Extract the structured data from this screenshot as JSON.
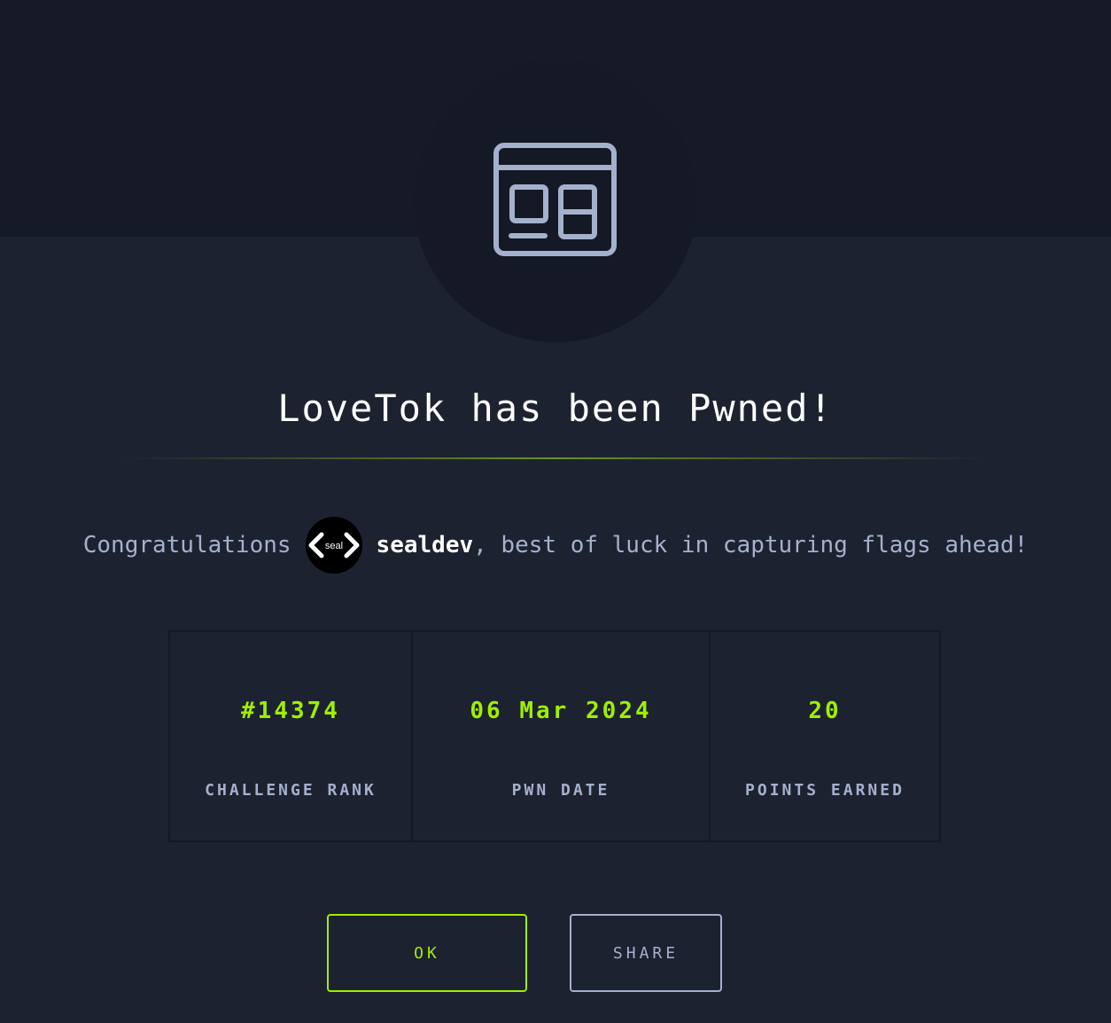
{
  "modal": {
    "icon": "web-layout-icon",
    "title": "LoveTok has been Pwned!",
    "congrats_prefix": "Congratulations",
    "avatar_text": "seal",
    "username": "sealdev",
    "congrats_suffix": ", best of luck in capturing flags ahead!"
  },
  "stats": [
    {
      "value": "#14374",
      "label": "CHALLENGE RANK"
    },
    {
      "value": "06 Mar 2024",
      "label": "PWN DATE"
    },
    {
      "value": "20",
      "label": "POINTS EARNED"
    }
  ],
  "buttons": {
    "ok_label": "OK",
    "share_label": "SHARE"
  },
  "colors": {
    "accent": "#9fef00",
    "background": "#1d2230",
    "header_band": "#151a26",
    "muted_text": "#a4b1cd",
    "icon_stroke": "#a4b1cd"
  }
}
